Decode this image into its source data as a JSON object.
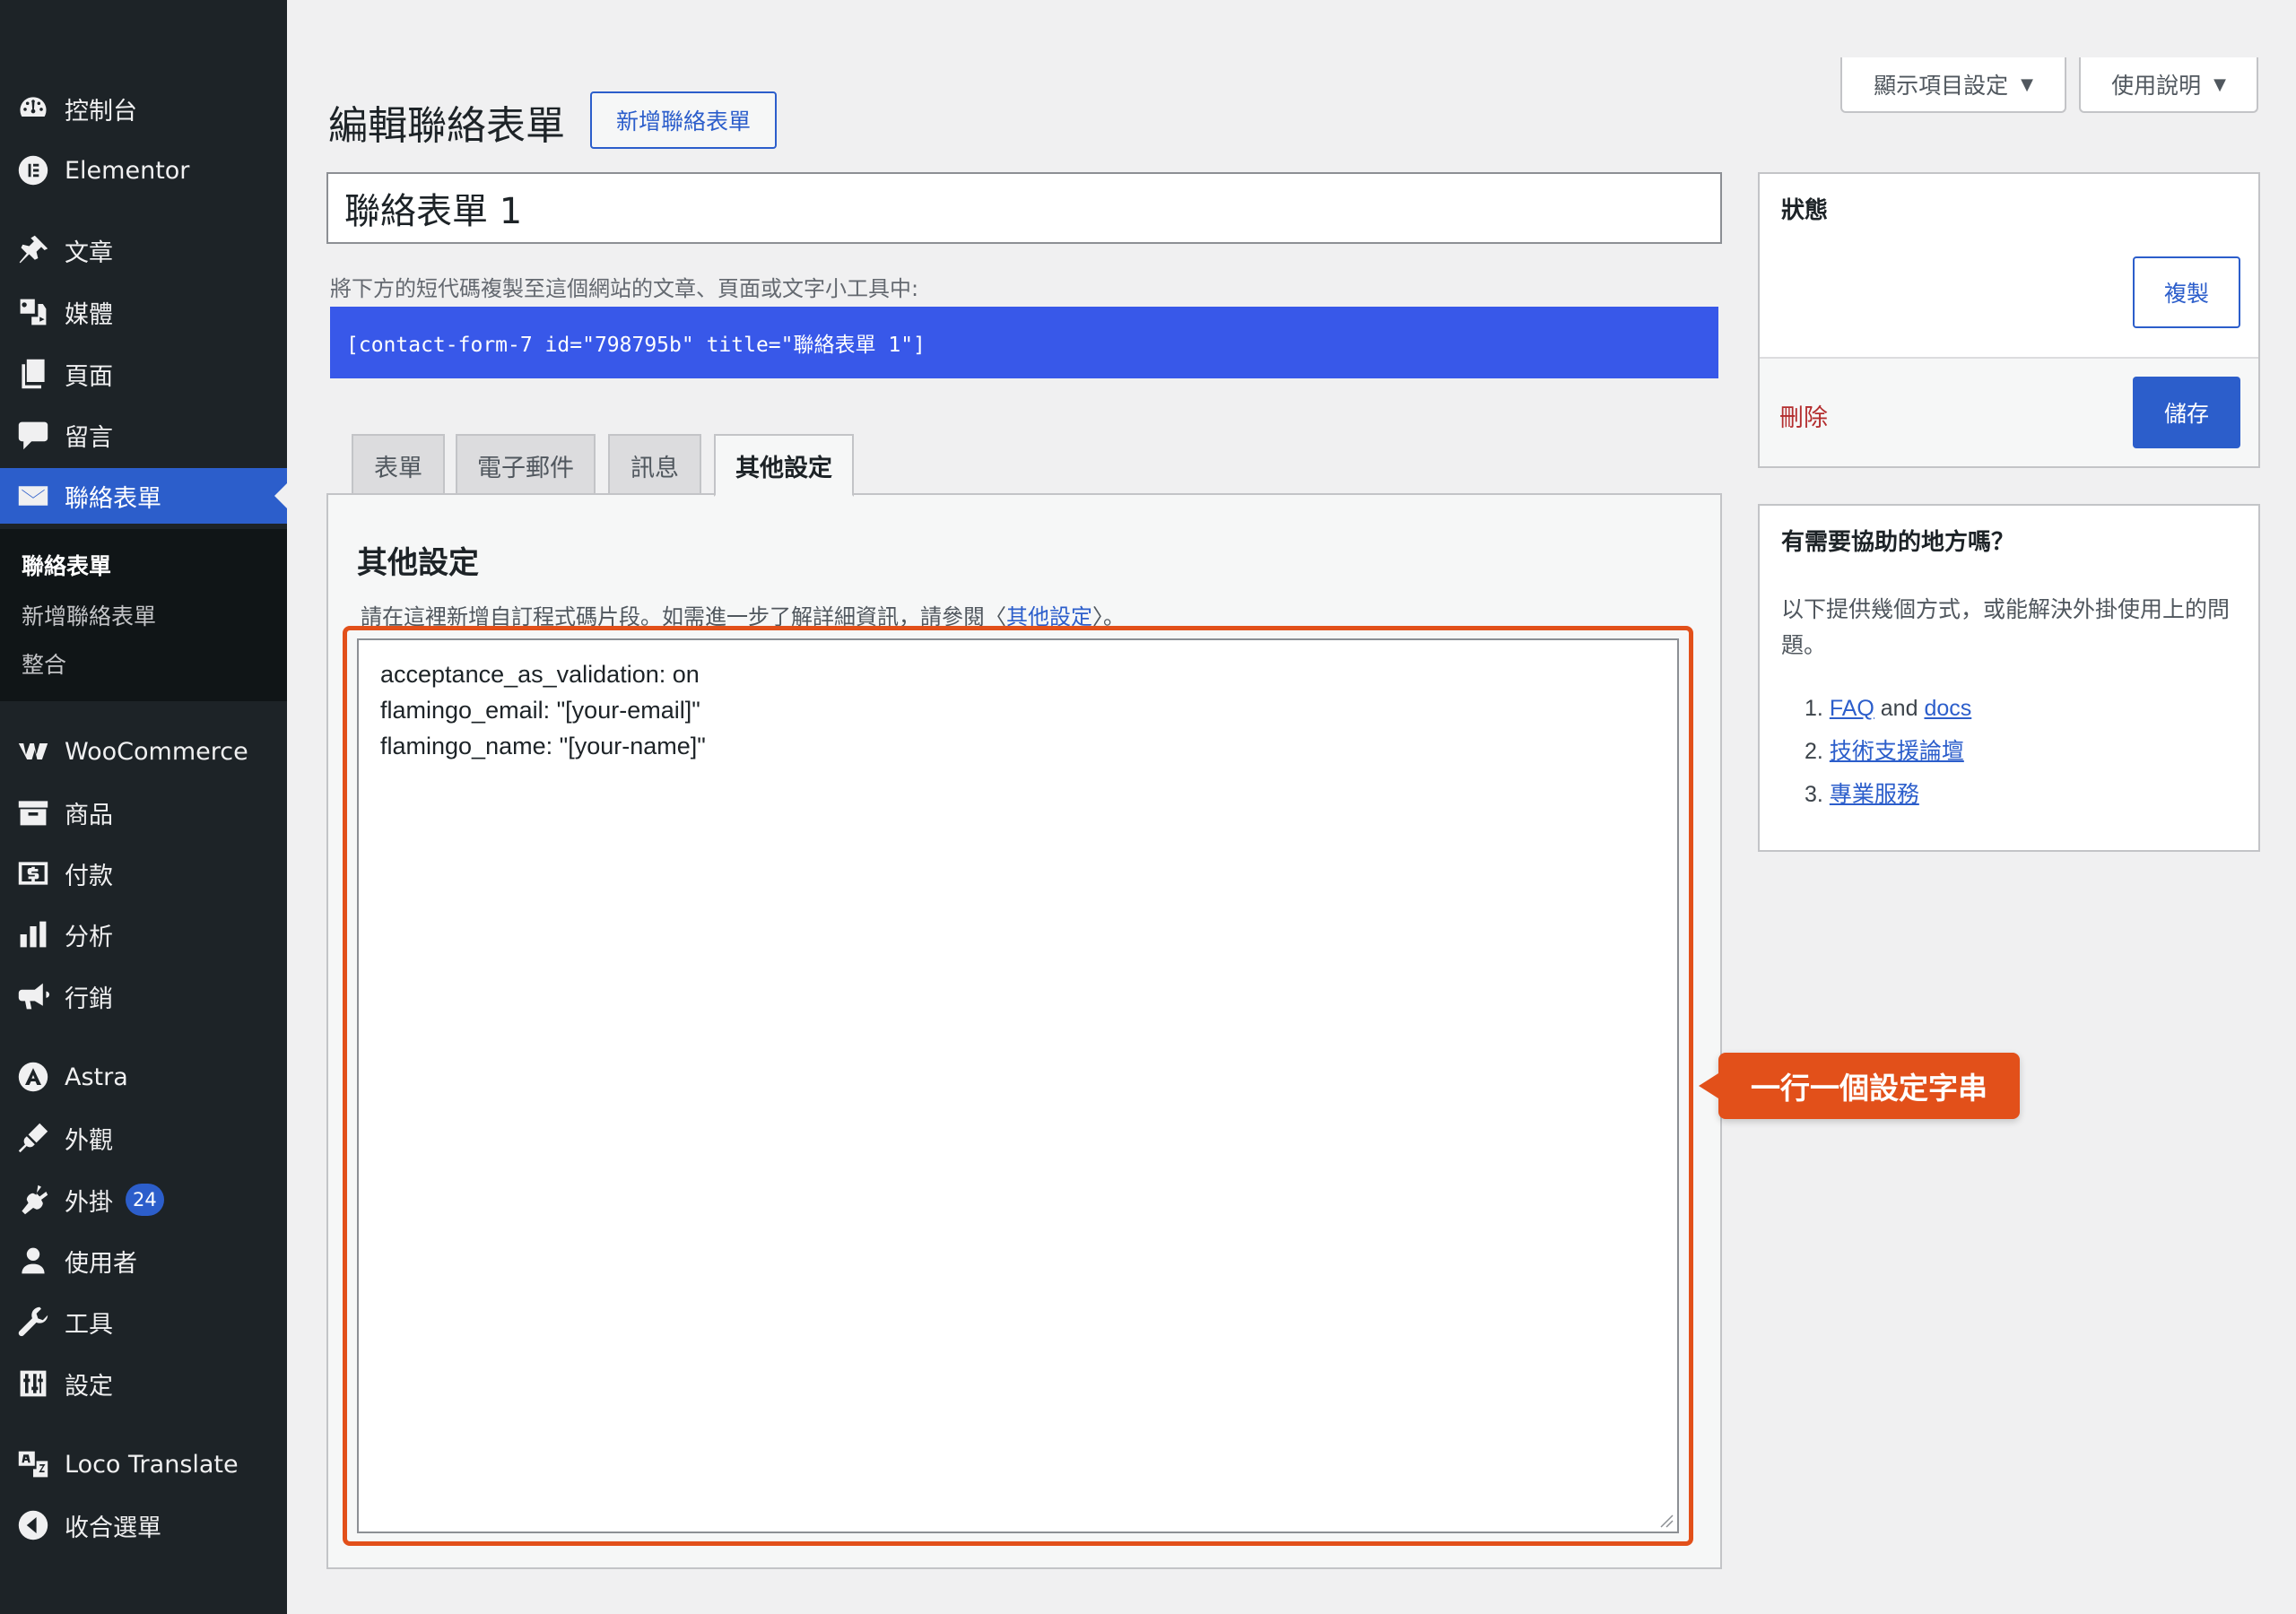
{
  "sidebar": {
    "items": [
      {
        "label": "控制台",
        "icon": "dashboard-icon"
      },
      {
        "label": "Elementor",
        "icon": "elementor-icon"
      },
      {
        "label": "文章",
        "icon": "pin-icon"
      },
      {
        "label": "媒體",
        "icon": "media-icon"
      },
      {
        "label": "頁面",
        "icon": "pages-icon"
      },
      {
        "label": "留言",
        "icon": "comment-icon"
      },
      {
        "label": "聯絡表單",
        "icon": "mail-icon"
      },
      {
        "label": "WooCommerce",
        "icon": "woocommerce-icon"
      },
      {
        "label": "商品",
        "icon": "archive-icon"
      },
      {
        "label": "付款",
        "icon": "payment-icon"
      },
      {
        "label": "分析",
        "icon": "analytics-icon"
      },
      {
        "label": "行銷",
        "icon": "megaphone-icon"
      },
      {
        "label": "Astra",
        "icon": "astra-icon"
      },
      {
        "label": "外觀",
        "icon": "brush-icon"
      },
      {
        "label": "外掛",
        "icon": "plugin-icon",
        "badge": "24"
      },
      {
        "label": "使用者",
        "icon": "user-icon"
      },
      {
        "label": "工具",
        "icon": "wrench-icon"
      },
      {
        "label": "設定",
        "icon": "settings-icon"
      },
      {
        "label": "Loco Translate",
        "icon": "translate-icon"
      },
      {
        "label": "收合選單",
        "icon": "collapse-icon"
      }
    ],
    "submenu": [
      "聯絡表單",
      "新增聯絡表單",
      "整合"
    ]
  },
  "topbar": {
    "screen_options": "顯示項目設定",
    "help": "使用說明"
  },
  "header": {
    "title": "編輯聯絡表單",
    "add_new": "新增聯絡表單"
  },
  "form": {
    "title_value": "聯絡表單 1",
    "shortcode_hint": "將下方的短代碼複製至這個網站的文章、頁面或文字小工具中:",
    "shortcode": "[contact-form-7 id=\"798795b\" title=\"聯絡表單 1\"]"
  },
  "tabs": [
    "表單",
    "電子郵件",
    "訊息",
    "其他設定"
  ],
  "panel": {
    "heading": "其他設定",
    "desc_before": "請在這裡新增自訂程式碼片段。如需進一步了解詳細資訊，請參閱〈",
    "desc_link": "其他設定",
    "desc_after": "〉。",
    "lines": [
      "acceptance_as_validation: on",
      "flamingo_email: \"[your-email]\"",
      "flamingo_name: \"[your-name]\""
    ]
  },
  "callout": "一行一個設定字串",
  "status": {
    "title": "狀態",
    "copy": "複製",
    "delete": "刪除",
    "save": "儲存"
  },
  "help_box": {
    "title": "有需要協助的地方嗎？",
    "desc": "以下提供幾個方式，或能解決外掛使用上的問題。",
    "item1_num": "1.",
    "item1_link1": "FAQ",
    "item1_and": "and",
    "item1_link2": "docs",
    "item2_num": "2.",
    "item2_link": "技術支援論壇",
    "item3_num": "3.",
    "item3_link": "專業服務"
  },
  "colors": {
    "sidebar_bg": "#1d2327",
    "accent": "#2c5ecb",
    "shortcode_bg": "#3858e9",
    "highlight": "#e2501a",
    "delete": "#b32d2e"
  }
}
